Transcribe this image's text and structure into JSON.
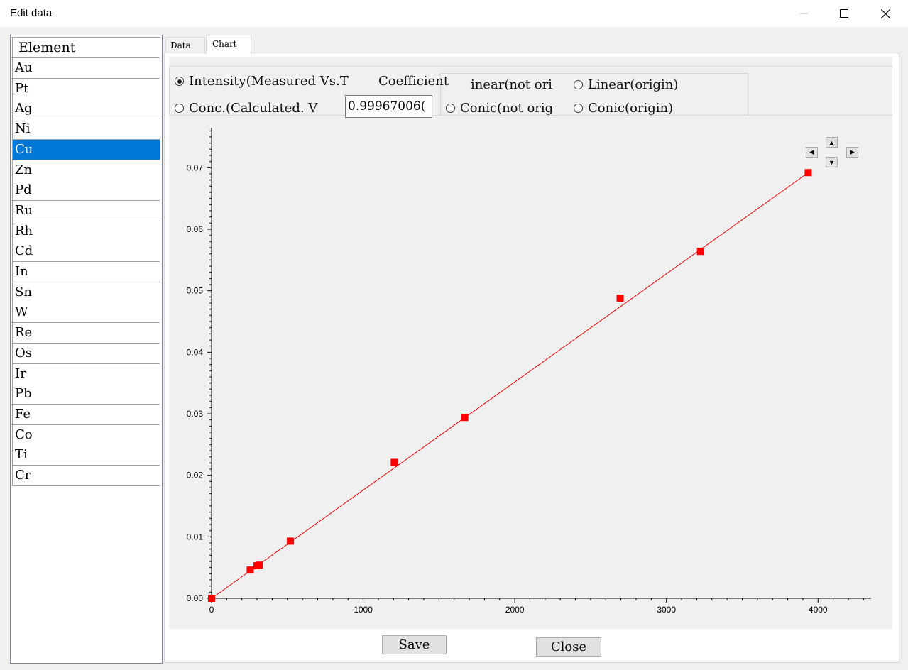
{
  "window": {
    "title": "Edit data",
    "minimize_icon": "minimize-icon",
    "maximize_icon": "maximize-icon",
    "close_icon": "close-icon"
  },
  "element_list": {
    "header": "Element",
    "selected": "Cu",
    "items": [
      "Au",
      "Pt",
      "Ag",
      "Ni",
      "Cu",
      "Zn",
      "Pd",
      "Ru",
      "Rh",
      "Cd",
      "In",
      "Sn",
      "W",
      "Re",
      "Os",
      "Ir",
      "Pb",
      "Fe",
      "Co",
      "Ti",
      "Cr"
    ]
  },
  "tabs": {
    "data": "Data",
    "chart": "Chart",
    "active": "Chart"
  },
  "options": {
    "mode_intensity": "Intensity(Measured Vs.T",
    "mode_conc": "Conc.(Calculated. V",
    "coefficient_label": "Coefficient",
    "coefficient_value": "0.99967006(",
    "fit_linear_not_origin": "inear(not ori",
    "fit_linear_origin": "Linear(origin)",
    "fit_conic_not_origin": "Conic(not orig",
    "fit_conic_origin": "Conic(origin)",
    "selected_mode": "intensity"
  },
  "buttons": {
    "save": "Save",
    "close": "Close"
  },
  "colors": {
    "series": "#ff0000",
    "selection": "#0078d7"
  },
  "chart_data": {
    "type": "scatter",
    "x_ticks": [
      "0",
      "1000",
      "2000",
      "3000",
      "4000"
    ],
    "y_ticks": [
      "0.00",
      "0.01",
      "0.02",
      "0.03",
      "0.04",
      "0.05",
      "0.06",
      "0.07"
    ],
    "xlim": [
      0,
      4350
    ],
    "ylim": [
      0,
      0.0765
    ],
    "grid": false,
    "points": [
      [
        0,
        0.0
      ],
      [
        255,
        0.0046
      ],
      [
        300,
        0.0053
      ],
      [
        315,
        0.0054
      ],
      [
        520,
        0.0093
      ],
      [
        1205,
        0.0221
      ],
      [
        1670,
        0.0294
      ],
      [
        2695,
        0.0488
      ],
      [
        3225,
        0.0564
      ],
      [
        3935,
        0.0692
      ]
    ],
    "fit_line": [
      [
        0,
        0.0
      ],
      [
        3935,
        0.0692
      ]
    ]
  }
}
